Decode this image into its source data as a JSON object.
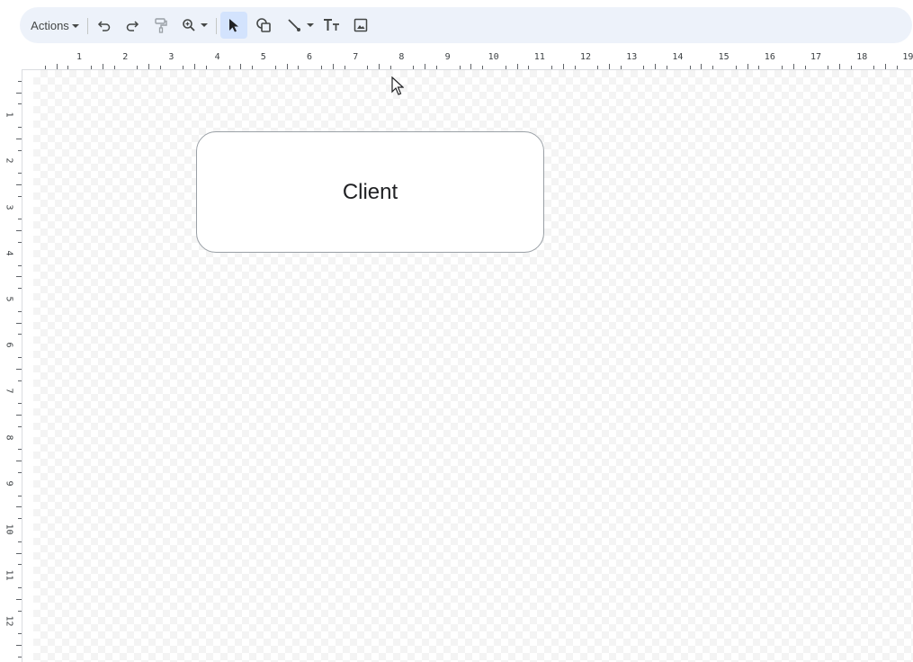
{
  "toolbar": {
    "actions_label": "Actions",
    "tools": [
      {
        "name": "undo-icon"
      },
      {
        "name": "redo-icon"
      },
      {
        "name": "paint-format-icon"
      },
      {
        "name": "zoom-icon"
      },
      {
        "name": "select-icon"
      },
      {
        "name": "shape-icon"
      },
      {
        "name": "line-icon"
      },
      {
        "name": "text-box-icon"
      },
      {
        "name": "image-icon"
      }
    ],
    "active_tool": "select",
    "accent_color": "#d3e3fd",
    "background_color": "#edf2fa"
  },
  "ruler": {
    "horizontal_labels": [
      "1",
      "2",
      "3",
      "4",
      "5",
      "6",
      "7",
      "8",
      "9",
      "10",
      "11",
      "12",
      "13",
      "14",
      "15",
      "16",
      "17",
      "18",
      "19"
    ],
    "vertical_labels": [
      "1",
      "2",
      "3",
      "4",
      "5",
      "6",
      "7",
      "8",
      "9",
      "10",
      "11",
      "12"
    ]
  },
  "canvas": {
    "shapes": [
      {
        "type": "rounded-rectangle",
        "label": "Client"
      }
    ]
  }
}
